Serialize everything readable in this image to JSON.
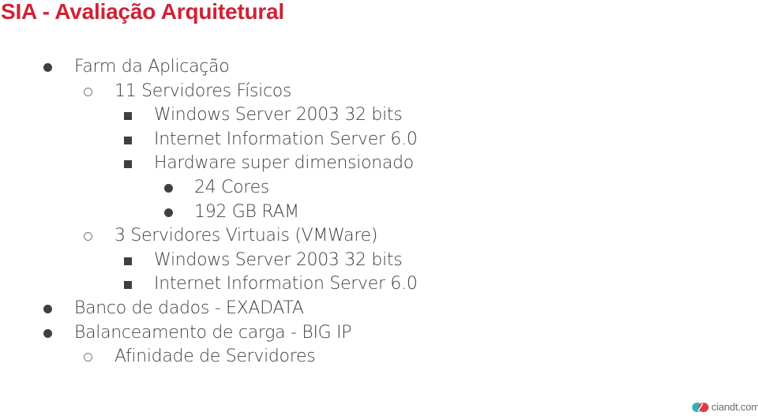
{
  "slide": {
    "title": "SIA - Avaliação Arquitetural",
    "outline": [
      {
        "level": 1,
        "bullet": "disc",
        "text": "Farm da Aplicação"
      },
      {
        "level": 2,
        "bullet": "circle",
        "text": "11 Servidores Físicos"
      },
      {
        "level": 3,
        "bullet": "square",
        "text": "Windows Server 2003 32 bits"
      },
      {
        "level": 3,
        "bullet": "square",
        "text": "Internet Information Server 6.0"
      },
      {
        "level": 3,
        "bullet": "square",
        "text": "Hardware super dimensionado"
      },
      {
        "level": 4,
        "bullet": "disc",
        "text": "24 Cores"
      },
      {
        "level": 4,
        "bullet": "disc",
        "text": "192 GB RAM"
      },
      {
        "level": 2,
        "bullet": "circle",
        "text": "3 Servidores Virtuais (VMWare)"
      },
      {
        "level": 3,
        "bullet": "square",
        "text": "Windows Server 2003 32 bits"
      },
      {
        "level": 3,
        "bullet": "square",
        "text": "Internet Information Server 6.0"
      },
      {
        "level": 1,
        "bullet": "disc",
        "text": "Banco de dados - EXADATA"
      },
      {
        "level": 1,
        "bullet": "disc",
        "text": "Balanceamento de carga - BIG IP"
      },
      {
        "level": 2,
        "bullet": "circle",
        "text": "Afinidade de Servidores"
      }
    ]
  },
  "footer": {
    "logo_icon": "ciandt-logo-icon",
    "logo_text": "ciandt.com"
  },
  "colors": {
    "title": "#d02235",
    "body_text": "#3f3f3f",
    "logo_teal": "#2cb5b8",
    "logo_red": "#e03a48"
  }
}
